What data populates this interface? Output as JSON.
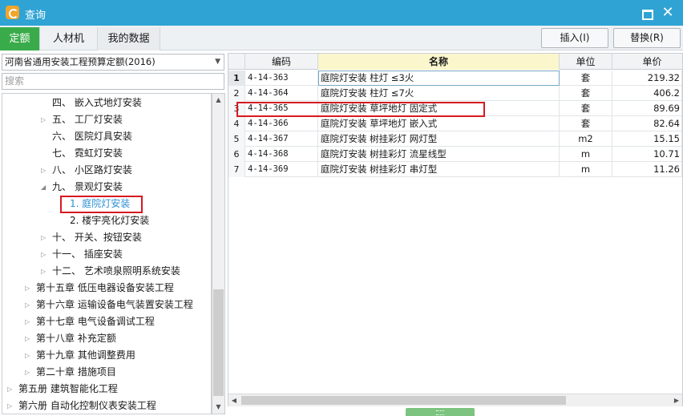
{
  "window": {
    "title": "查询",
    "minimize_icon": "restore-icon",
    "close_glyph": "✕"
  },
  "tabs": [
    {
      "label": "定额",
      "active": true
    },
    {
      "label": "人材机",
      "active": false
    },
    {
      "label": "我的数据",
      "active": false
    }
  ],
  "toolbar": {
    "insert_label": "插入(I)",
    "replace_label": "替换(R)"
  },
  "left": {
    "library_value": "河南省通用安装工程预算定额(2016)",
    "search_placeholder": "搜索",
    "tree": [
      {
        "label": "四、 嵌入式地灯安装",
        "expander": "",
        "depth": 3
      },
      {
        "label": "五、 工厂灯安装",
        "expander": "▷",
        "depth": 3
      },
      {
        "label": "六、 医院灯具安装",
        "expander": "",
        "depth": 3
      },
      {
        "label": "七、 霓虹灯安装",
        "expander": "",
        "depth": 3
      },
      {
        "label": "八、 小区路灯安装",
        "expander": "▷",
        "depth": 3
      },
      {
        "label": "九、 景观灯安装",
        "expander": "◢",
        "depth": 3
      },
      {
        "label": "1. 庭院灯安装",
        "expander": "",
        "depth": 4,
        "selected": true
      },
      {
        "label": "2. 楼宇亮化灯安装",
        "expander": "",
        "depth": 4
      },
      {
        "label": "十、 开关、按钮安装",
        "expander": "▷",
        "depth": 3
      },
      {
        "label": "十一、 插座安装",
        "expander": "▷",
        "depth": 3
      },
      {
        "label": "十二、 艺术喷泉照明系统安装",
        "expander": "▷",
        "depth": 3
      },
      {
        "label": "第十五章 低压电器设备安装工程",
        "expander": "▷",
        "depth": 2
      },
      {
        "label": "第十六章 运输设备电气装置安装工程",
        "expander": "▷",
        "depth": 2
      },
      {
        "label": "第十七章 电气设备调试工程",
        "expander": "▷",
        "depth": 2
      },
      {
        "label": "第十八章 补充定额",
        "expander": "▷",
        "depth": 2
      },
      {
        "label": "第十九章 其他调整费用",
        "expander": "▷",
        "depth": 2
      },
      {
        "label": "第二十章 措施项目",
        "expander": "▷",
        "depth": 2
      },
      {
        "label": "第五册 建筑智能化工程",
        "expander": "▷",
        "depth": 1
      },
      {
        "label": "第六册 自动化控制仪表安装工程",
        "expander": "▷",
        "depth": 1
      }
    ]
  },
  "grid": {
    "columns": [
      "编码",
      "名称",
      "单位",
      "单价"
    ],
    "rows": [
      {
        "idx": "1",
        "code": "4-14-363",
        "name": "庭院灯安装 柱灯 ≤3火",
        "unit": "套",
        "price": "219.32",
        "current": true
      },
      {
        "idx": "2",
        "code": "4-14-364",
        "name": "庭院灯安装 柱灯 ≤7火",
        "unit": "套",
        "price": "406.2"
      },
      {
        "idx": "3",
        "code": "4-14-365",
        "name": "庭院灯安装 草坪地灯 固定式",
        "unit": "套",
        "price": "89.69"
      },
      {
        "idx": "4",
        "code": "4-14-366",
        "name": "庭院灯安装 草坪地灯 嵌入式",
        "unit": "套",
        "price": "82.64"
      },
      {
        "idx": "5",
        "code": "4-14-367",
        "name": "庭院灯安装 树挂彩灯 网灯型",
        "unit": "m2",
        "price": "15.15"
      },
      {
        "idx": "6",
        "code": "4-14-368",
        "name": "庭院灯安装 树挂彩灯 流星线型",
        "unit": "m",
        "price": "10.71"
      },
      {
        "idx": "7",
        "code": "4-14-369",
        "name": "庭院灯安装 树挂彩灯 串灯型",
        "unit": "m",
        "price": "11.26"
      }
    ]
  },
  "colors": {
    "titlebar": "#2fa3d4",
    "active_tab": "#3aab4a",
    "highlight_box": "#d71920",
    "name_header": "#fbf6cc",
    "selected_tree_text": "#2d8fd2"
  }
}
